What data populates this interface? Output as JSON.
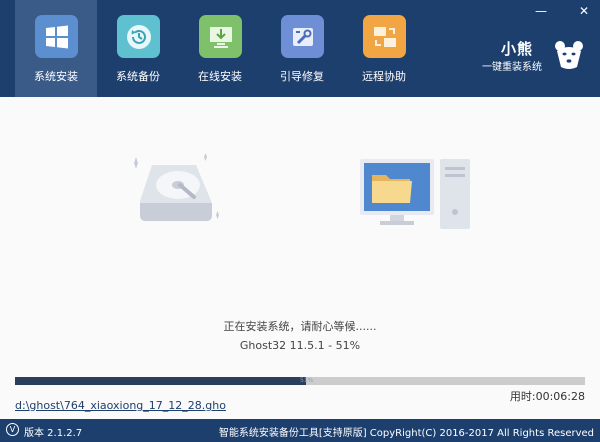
{
  "window": {
    "minimize_symbol": "—",
    "close_symbol": "✕"
  },
  "nav": {
    "items": [
      {
        "label": "系统安装",
        "icon": "windows-icon"
      },
      {
        "label": "系统备份",
        "icon": "backup-restore-icon"
      },
      {
        "label": "在线安装",
        "icon": "download-icon"
      },
      {
        "label": "引导修复",
        "icon": "repair-tools-icon"
      },
      {
        "label": "远程协助",
        "icon": "remote-assist-icon"
      }
    ],
    "active_index": 0
  },
  "brand": {
    "name": "小熊",
    "slogan": "一键重装系统",
    "logo": "bear-logo"
  },
  "main": {
    "status": "正在安装系统，请耐心等候......",
    "version_progress": "Ghost32 11.5.1 - 51%",
    "progress": {
      "fraction": 0.51,
      "label": "51%"
    },
    "elapsed": "用时:00:06:28",
    "file_path": "d:\\ghost\\764_xiaoxiong_17_12_28.gho"
  },
  "footer": {
    "version_icon": "V",
    "version": "版本 2.1.2.7",
    "copyright": "智能系统安装备份工具[支持原版]    CopyRight(C) 2016-2017 All Rights Reserved"
  },
  "colors": {
    "header_bg": "#1d3f6e",
    "active_nav_bg": "#3a5a88",
    "progress_fill": "#2b3e5b",
    "progress_track": "#cccccc"
  }
}
